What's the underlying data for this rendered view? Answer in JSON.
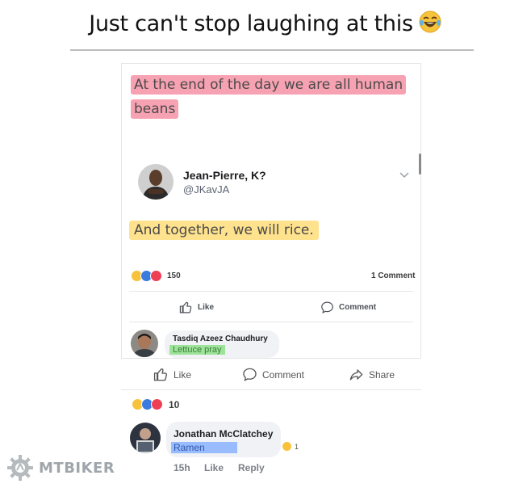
{
  "caption": {
    "text": "Just can't stop laughing at this",
    "emoji": "laughing-tears-emoji"
  },
  "card": {
    "post_text": "At the end of the day we are all human beans",
    "author_name": "Jean-Pierre, K?",
    "author_handle": "@JKavJA",
    "reply_text": "And together, we will rice.",
    "reaction_count": "150",
    "comment_count": "1 Comment",
    "like_label": "Like",
    "comment_label": "Comment",
    "first_comment": {
      "author": "Tasdiq Azeez Chaudhury",
      "text": "Lettuce pray"
    }
  },
  "outer_actions": {
    "like": "Like",
    "comment": "Comment",
    "share": "Share"
  },
  "outer_reaction_count": "10",
  "main_comment": {
    "author": "Jonathan McClatchey",
    "text": "Ramen",
    "reaction_count": "1",
    "time": "15h",
    "like": "Like",
    "reply": "Reply"
  },
  "watermark": {
    "text": "MTBIKER"
  },
  "colors": {
    "pink_highlight": "#f26982",
    "yellow_highlight": "#ffd65c",
    "green_highlight": "#8fe08a",
    "blue_highlight": "#8ab3ff"
  }
}
